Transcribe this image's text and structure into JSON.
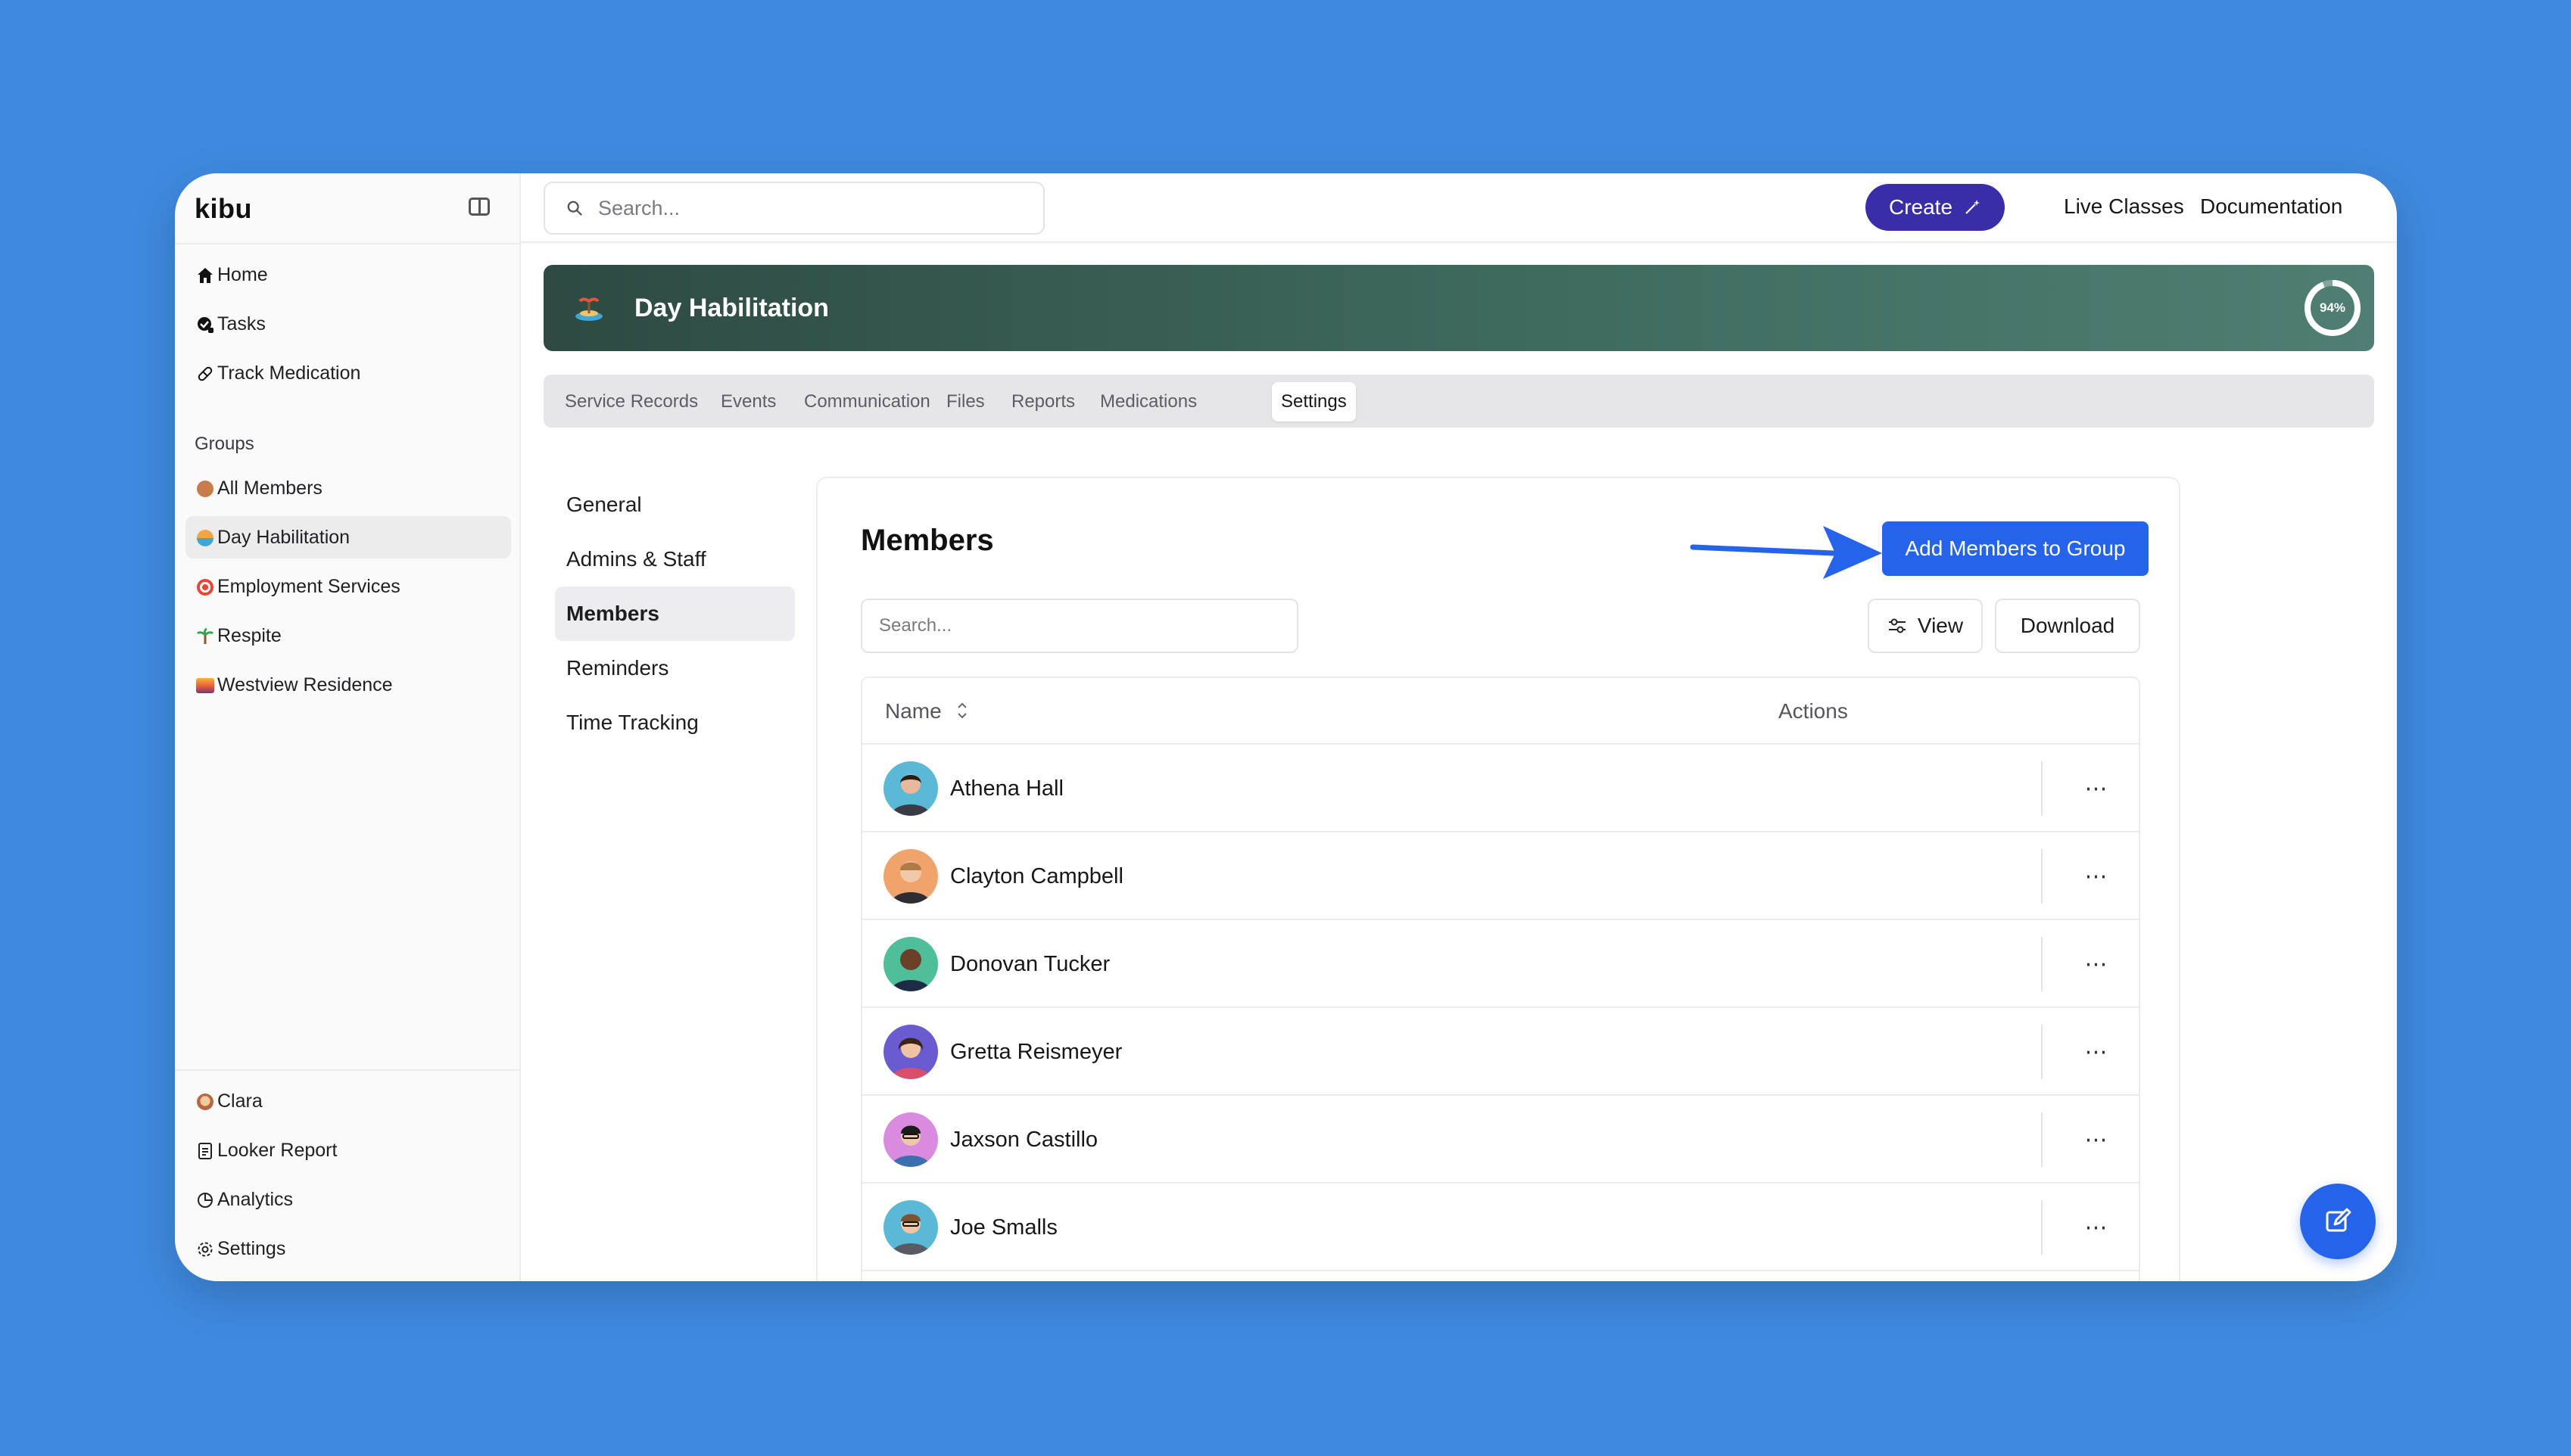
{
  "app": {
    "brand": "kibu"
  },
  "sidebar": {
    "nav": [
      {
        "label": "Home",
        "icon": "home-icon"
      },
      {
        "label": "Tasks",
        "icon": "tasks-icon"
      },
      {
        "label": "Track Medication",
        "icon": "pill-icon"
      }
    ],
    "groups_heading": "Groups",
    "groups": [
      {
        "label": "All Members",
        "icon": "people-emoji-icon"
      },
      {
        "label": "Day Habilitation",
        "icon": "island-emoji-icon",
        "active": true
      },
      {
        "label": "Employment Services",
        "icon": "target-emoji-icon"
      },
      {
        "label": "Respite",
        "icon": "palm-emoji-icon"
      },
      {
        "label": "Westview Residence",
        "icon": "sunset-emoji-icon"
      }
    ],
    "footer": [
      {
        "label": "Clara",
        "icon": "user-avatar-icon"
      },
      {
        "label": "Looker Report",
        "icon": "document-icon"
      },
      {
        "label": "Analytics",
        "icon": "pie-chart-icon"
      },
      {
        "label": "Settings",
        "icon": "gear-icon"
      }
    ]
  },
  "topbar": {
    "search_placeholder": "Search...",
    "create_label": "Create",
    "live_classes": "Live Classes",
    "documentation": "Documentation"
  },
  "banner": {
    "title": "Day Habilitation",
    "progress_label": "94%",
    "progress_value": 0.94
  },
  "tabs": [
    {
      "label": "Service Records"
    },
    {
      "label": "Events"
    },
    {
      "label": "Communication"
    },
    {
      "label": "Files"
    },
    {
      "label": "Reports"
    },
    {
      "label": "Medications"
    },
    {
      "label": "Settings",
      "active": true
    }
  ],
  "settings_nav": [
    {
      "label": "General"
    },
    {
      "label": "Admins & Staff"
    },
    {
      "label": "Members",
      "active": true
    },
    {
      "label": "Reminders"
    },
    {
      "label": "Time Tracking"
    }
  ],
  "members": {
    "title": "Members",
    "add_button": "Add Members to Group",
    "search_placeholder": "Search...",
    "view_label": "View",
    "download_label": "Download",
    "columns": {
      "name": "Name",
      "actions": "Actions"
    },
    "rows": [
      {
        "name": "Athena Hall",
        "avatar_bg": "#5bb8d6"
      },
      {
        "name": "Clayton Campbell",
        "avatar_bg": "#f0a36b"
      },
      {
        "name": "Donovan Tucker",
        "avatar_bg": "#4fbf9a"
      },
      {
        "name": "Gretta Reismeyer",
        "avatar_bg": "#6a5bd0"
      },
      {
        "name": "Jaxson Castillo",
        "avatar_bg": "#d98bdf"
      },
      {
        "name": "Joe Smalls",
        "avatar_bg": "#5bb8d6"
      }
    ],
    "row_action": "⋯"
  },
  "colors": {
    "background": "#3f8ae0",
    "primary": "#2563eb",
    "create": "#3a2ea8",
    "banner": "#3f6b5f"
  }
}
